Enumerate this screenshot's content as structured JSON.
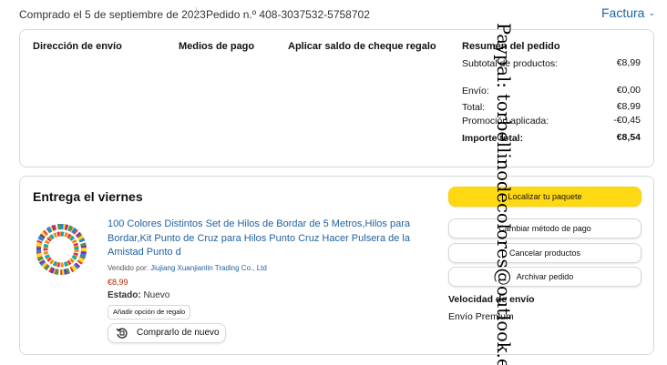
{
  "header": {
    "ordered_on": "Comprado el 5 de septiembre de 2023",
    "order_number": "Pedido n.º 408-3037532-5758702",
    "invoice_label": "Factura",
    "invoice_icon": "chevron-down-icon"
  },
  "order_info": {
    "shipping_address_heading": "Dirección de envío",
    "payment_methods_heading": "Medios de pago",
    "gift_balance_heading": "Aplicar saldo de cheque regalo",
    "summary_heading": "Resumen del pedido",
    "summary": [
      {
        "label": "Subtotal de productos:",
        "value": "€8,99"
      },
      {
        "label": "Envío:",
        "value": "€0,00"
      },
      {
        "label": "Total:",
        "value": "€8,99"
      },
      {
        "label": "Promoción aplicada:",
        "value": "-€0,45"
      },
      {
        "label": "Importe total:",
        "value": "€8,54"
      }
    ]
  },
  "delivery": {
    "title": "Entrega el viernes",
    "product": {
      "title": "100 Colores Distintos Set de Hilos de Bordar de 5 Metros,Hilos para Bordar,Kit Punto de Cruz para Hilos Punto Cruz Hacer Pulsera de la Amistad Punto d",
      "sold_by_label": "Vendido por:",
      "seller": "Jiujiang Xuanjianlin Trading Co., Ltd",
      "price": "€8,99",
      "condition_label": "Estado:",
      "condition": "Nuevo",
      "gift_option_label": "Añadir opción de regalo",
      "buy_again_label": "Comprarlo de nuevo",
      "buy_again_icon": "buy-again-icon"
    },
    "actions": [
      {
        "label": "Localizar tu paquete",
        "primary": true
      },
      {
        "label": "Cambiar método de pago",
        "primary": false
      },
      {
        "label": "Cancelar productos",
        "primary": false
      },
      {
        "label": "Archivar pedido",
        "primary": false
      }
    ],
    "shipping_speed_heading": "Velocidad de envío",
    "shipping_speed": "Envío Premium"
  },
  "overlay_text": "Paypal: torbellinodecolores@outlook.es",
  "colors": {
    "link": "#2162a1",
    "price": "#b12704",
    "primary_button": "#ffd814",
    "border": "#d5d9d9"
  }
}
